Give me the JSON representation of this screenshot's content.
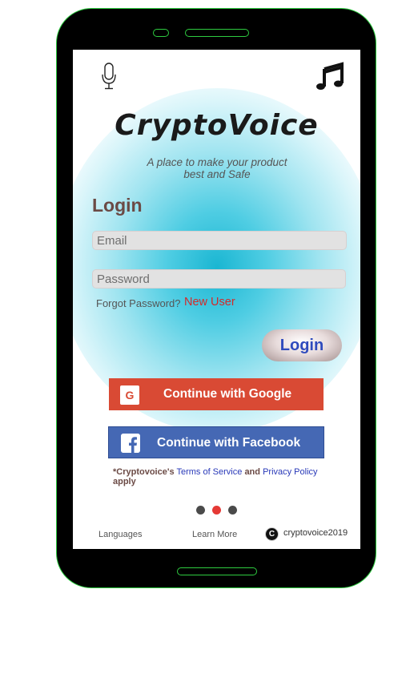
{
  "app": {
    "title": "CryptoVoice",
    "tagline": "A place to make your product best and Safe"
  },
  "icons": {
    "mic": "microphone-icon",
    "music": "music-note-icon",
    "google": "google-icon",
    "facebook": "facebook-icon",
    "copyright": "copyright-icon"
  },
  "login": {
    "heading": "Login",
    "email_placeholder": "Email",
    "password_placeholder": "Password",
    "forgot_label": "Forgot Password?",
    "new_user_label": "New User",
    "button_label": "Login"
  },
  "social": {
    "google_icon_letter": "G",
    "google_label": "Continue with Google",
    "facebook_label": "Continue with Facebook"
  },
  "terms": {
    "prefix": "*Cryptovoice's",
    "terms_link": "Terms of Service",
    "and": "and",
    "privacy_link": "Privacy Policy",
    "suffix": "apply"
  },
  "pager": {
    "count": 3,
    "active_index": 1
  },
  "footer": {
    "languages": "Languages",
    "learn_more": "Learn More",
    "copyright_symbol": "C",
    "copyright": "cryptovoice2019"
  },
  "colors": {
    "phone_outline": "#2ecc40",
    "glow": "#1ab6d2",
    "google": "#d94a34",
    "facebook": "#4568b4",
    "login_text": "#2f4bbd",
    "new_user": "#d42a2a",
    "pager_active": "#e53935"
  }
}
